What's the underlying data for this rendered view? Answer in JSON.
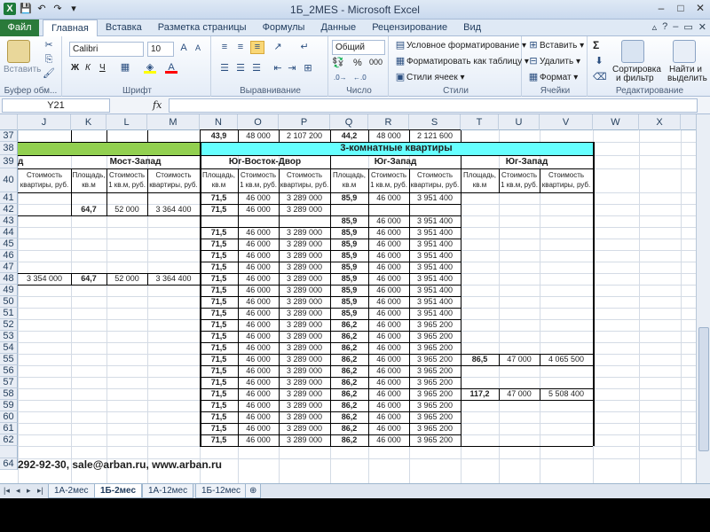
{
  "window": {
    "title": "1Б_2MES  -  Microsoft Excel",
    "app_icon": "X",
    "controls": [
      "–",
      "□",
      "✕"
    ]
  },
  "tabs": {
    "file": "Файл",
    "items": [
      "Главная",
      "Вставка",
      "Разметка страницы",
      "Формулы",
      "Данные",
      "Рецензирование",
      "Вид"
    ],
    "active": "Главная"
  },
  "ribbon": {
    "clipboard": {
      "paste": "Вставить",
      "label": "Буфер обм..."
    },
    "font": {
      "name": "Calibri",
      "size": "10",
      "label": "Шрифт",
      "bold": "Ж",
      "italic": "К",
      "underline": "Ч"
    },
    "alignment": {
      "label": "Выравнивание"
    },
    "number": {
      "format": "Общий",
      "percent": "%",
      "thousands": "000",
      "label": "Число"
    },
    "styles": {
      "conditional": "Условное форматирование",
      "as_table": "Форматировать как таблицу",
      "cell_styles": "Стили ячеек",
      "label": "Стили"
    },
    "cells": {
      "insert": "Вставить",
      "delete": "Удалить",
      "format": "Формат",
      "label": "Ячейки"
    },
    "editing": {
      "sum": "Σ",
      "sort": "Сортировка",
      "sort2": "и фильтр",
      "find": "Найти и",
      "find2": "выделить",
      "label": "Редактирование"
    }
  },
  "formula_bar": {
    "name_box": "Y21",
    "fx": "fx",
    "value": ""
  },
  "columns": [
    "J",
    "K",
    "L",
    "M",
    "N",
    "O",
    "P",
    "Q",
    "R",
    "S",
    "T",
    "U",
    "V",
    "W",
    "X"
  ],
  "header": {
    "row38_title": "3-комнатные квартиры",
    "row39": {
      "j": "д",
      "most_zapad": "Мост-Запад",
      "yug_vostok": "Юг-Восток-Двор",
      "yug_zapad1": "Юг-Запад",
      "yug_zapad2": "Юг-Запад"
    },
    "row40": {
      "j": "Стоимость квартиры, руб.",
      "area": "Площадь, кв.м",
      "ppm": "Стоимость 1 кв.м, руб.",
      "cost": "Стоимость квартиры, руб."
    }
  },
  "row37": {
    "n": "43,9",
    "o": "48 000",
    "p": "2 107 200",
    "q": "44,2",
    "r": "48 000",
    "s": "2 121 600"
  },
  "left_block": {
    "r42": {
      "k": "64,7",
      "l": "52 000",
      "m": "3 364 400"
    },
    "r48": {
      "j": "3 354 000",
      "k": "64,7",
      "l": "52 000",
      "m": "3 364 400"
    }
  },
  "nop_rows": {
    "area": "71,5",
    "ppm": "46 000",
    "cost": "3 289 000",
    "empty_rows": [
      43
    ]
  },
  "qrs_rows": [
    {
      "row": 41,
      "q": "85,9",
      "r": "46 000",
      "s": "3 951 400"
    },
    {
      "row": 43,
      "q": "85,9",
      "r": "46 000",
      "s": "3 951 400"
    },
    {
      "row": 44,
      "q": "85,9",
      "r": "46 000",
      "s": "3 951 400"
    },
    {
      "row": 45,
      "q": "85,9",
      "r": "46 000",
      "s": "3 951 400"
    },
    {
      "row": 46,
      "q": "85,9",
      "r": "46 000",
      "s": "3 951 400"
    },
    {
      "row": 47,
      "q": "85,9",
      "r": "46 000",
      "s": "3 951 400"
    },
    {
      "row": 48,
      "q": "85,9",
      "r": "46 000",
      "s": "3 951 400"
    },
    {
      "row": 49,
      "q": "85,9",
      "r": "46 000",
      "s": "3 951 400"
    },
    {
      "row": 50,
      "q": "85,9",
      "r": "46 000",
      "s": "3 951 400"
    },
    {
      "row": 51,
      "q": "85,9",
      "r": "46 000",
      "s": "3 951 400"
    },
    {
      "row": 52,
      "q": "86,2",
      "r": "46 000",
      "s": "3 965 200"
    },
    {
      "row": 53,
      "q": "86,2",
      "r": "46 000",
      "s": "3 965 200"
    },
    {
      "row": 54,
      "q": "86,2",
      "r": "46 000",
      "s": "3 965 200"
    },
    {
      "row": 55,
      "q": "86,2",
      "r": "46 000",
      "s": "3 965 200"
    },
    {
      "row": 56,
      "q": "86,2",
      "r": "46 000",
      "s": "3 965 200"
    },
    {
      "row": 57,
      "q": "86,2",
      "r": "46 000",
      "s": "3 965 200"
    },
    {
      "row": 58,
      "q": "86,2",
      "r": "46 000",
      "s": "3 965 200"
    },
    {
      "row": 59,
      "q": "86,2",
      "r": "46 000",
      "s": "3 965 200"
    },
    {
      "row": 60,
      "q": "86,2",
      "r": "46 000",
      "s": "3 965 200"
    },
    {
      "row": 61,
      "q": "86,2",
      "r": "46 000",
      "s": "3 965 200"
    },
    {
      "row": 62,
      "q": "86,2",
      "r": "46 000",
      "s": "3 965 200"
    }
  ],
  "tuv_rows": [
    {
      "row": 55,
      "t": "86,5",
      "u": "47 000",
      "v": "4 065 500"
    },
    {
      "row": 58,
      "t": "117,2",
      "u": "47 000",
      "v": "5 508 400"
    }
  ],
  "row_numbers": [
    "37",
    "38",
    "39",
    "40",
    "41",
    "42",
    "43",
    "44",
    "45",
    "46",
    "47",
    "48",
    "49",
    "50",
    "51",
    "52",
    "53",
    "54",
    "55",
    "56",
    "57",
    "58",
    "59",
    "60",
    "61",
    "62",
    "64"
  ],
  "contact": "292-92-30, sale@arban.ru, www.arban.ru",
  "sheets": [
    "1А-2мес",
    "1Б-2мес",
    "1А-12мес",
    "1Б-12мес"
  ],
  "active_sheet": "1Б-2мес",
  "colors": {
    "green_fill": "#92d050",
    "cyan_fill": "#66ffff",
    "file_tab": "#2a7a3a"
  }
}
